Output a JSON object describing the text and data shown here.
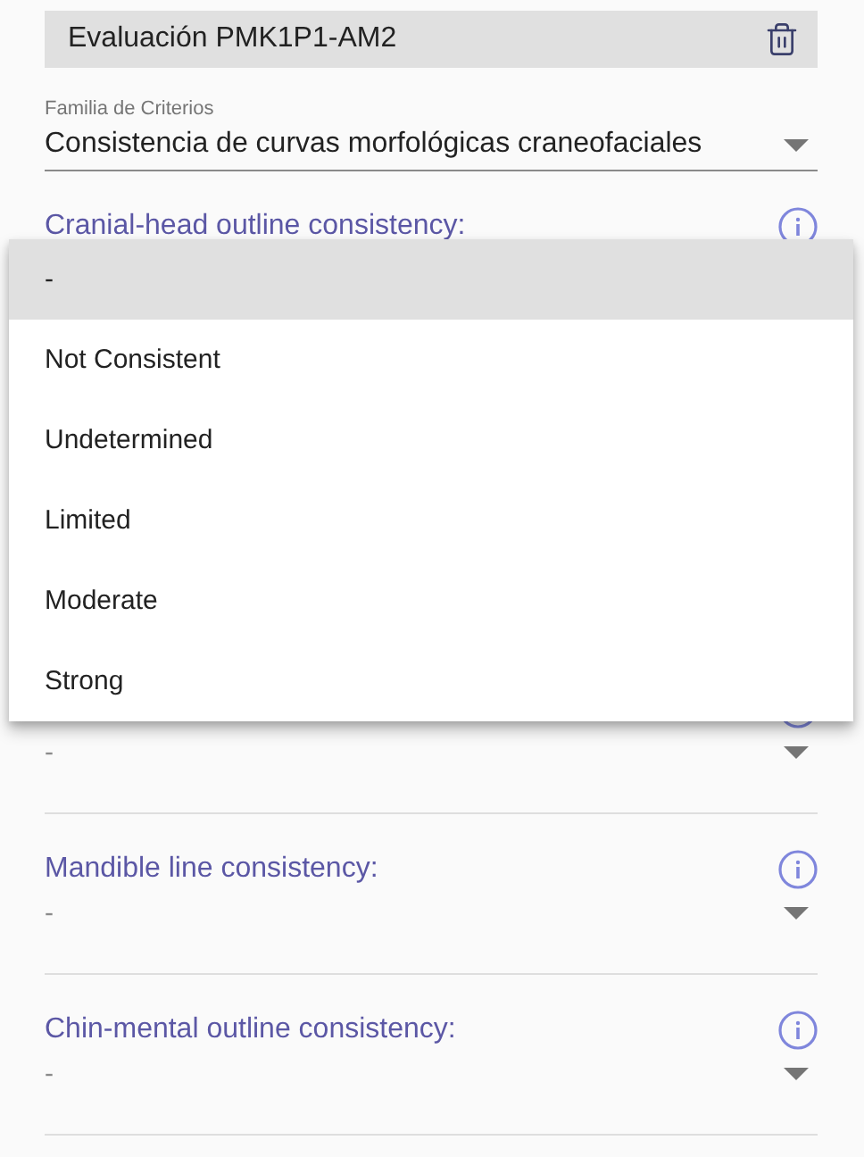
{
  "header": {
    "title": "Evaluación PMK1P1-AM2"
  },
  "family": {
    "label": "Familia de Criterios",
    "value": "Consistencia de curvas morfológicas craneofaciales"
  },
  "criteria": [
    {
      "label": "Cranial-head outline consistency:"
    },
    {
      "value": "-"
    },
    {
      "label": "Mandible line consistency:",
      "value": "-"
    },
    {
      "label": "Chin-mental outline consistency:",
      "value": "-"
    }
  ],
  "menu": [
    {
      "label": "-",
      "selected": true
    },
    {
      "label": "Not Consistent",
      "selected": false
    },
    {
      "label": "Undetermined",
      "selected": false
    },
    {
      "label": "Limited",
      "selected": false
    },
    {
      "label": "Moderate",
      "selected": false
    },
    {
      "label": "Strong",
      "selected": false
    }
  ]
}
